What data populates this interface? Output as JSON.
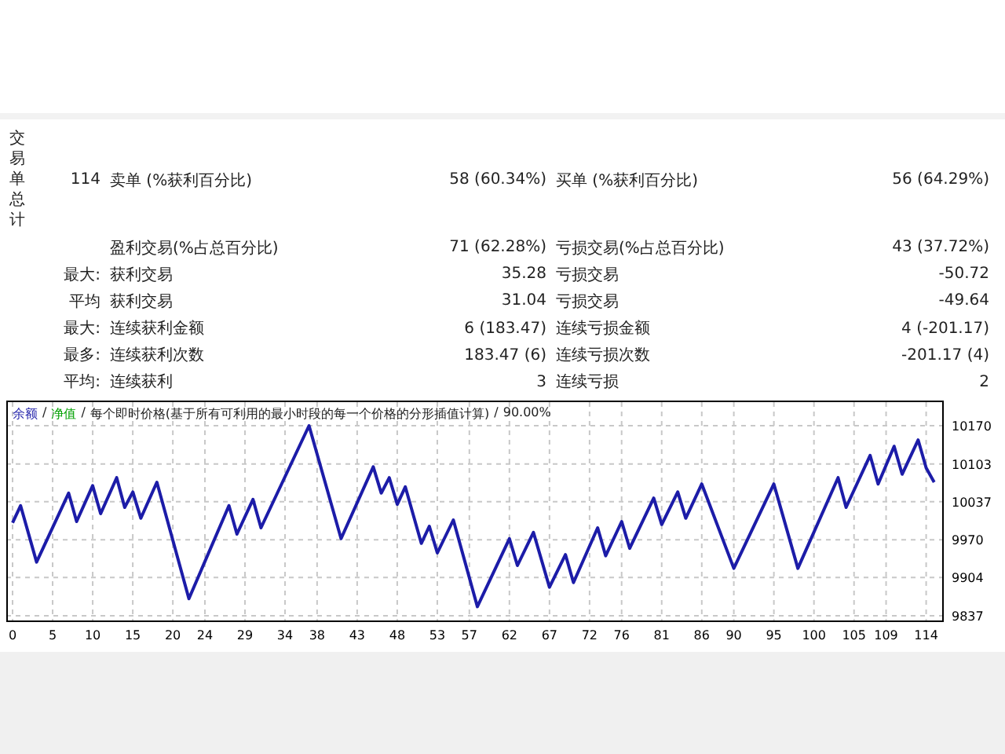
{
  "summary": {
    "side_label": "交易单总计",
    "rows": [
      {
        "prefix": "114",
        "label_1": "卖单 (%获利百分比)",
        "value_1": "58 (60.34%)",
        "label_2": "买单 (%获利百分比)",
        "value_2": "56 (64.29%)"
      },
      {
        "label_1": "盈利交易(%占总百分比)",
        "value_1": "71 (62.28%)",
        "label_2": "亏损交易(%占总百分比)",
        "value_2": "43 (37.72%)"
      },
      {
        "prefix": "最大:",
        "label_1": "获利交易",
        "value_1": "35.28",
        "label_2": "亏损交易",
        "value_2": "-50.72"
      },
      {
        "prefix": "平均",
        "label_1": "获利交易",
        "value_1": "31.04",
        "label_2": "亏损交易",
        "value_2": "-49.64"
      },
      {
        "prefix": "最大:",
        "label_1": "连续获利金额",
        "value_1": "6 (183.47)",
        "label_2": "连续亏损金额",
        "value_2": "4 (-201.17)"
      },
      {
        "prefix": "最多:",
        "label_1": "连续获利次数",
        "value_1": "183.47 (6)",
        "label_2": "连续亏损次数",
        "value_2": "-201.17 (4)"
      },
      {
        "prefix": "平均:",
        "label_1": "连续获利",
        "value_1": "3",
        "label_2": "连续亏损",
        "value_2": "2"
      }
    ]
  },
  "chart": {
    "separator": "/",
    "legend": [
      {
        "label": "净值",
        "color": "#00a000"
      }
    ],
    "model": "每个即时价格(基于所有可利用的最小时段的每一个价格的分形插值计算)",
    "quality": "90.00%",
    "chart_data": {
      "type": "line",
      "grid": true,
      "xlim": [
        0,
        116
      ],
      "ylim": [
        9837,
        10170
      ],
      "xticks": [
        0,
        5,
        10,
        15,
        20,
        24,
        29,
        34,
        38,
        43,
        48,
        53,
        57,
        62,
        67,
        72,
        76,
        81,
        86,
        90,
        95,
        100,
        105,
        109,
        114
      ],
      "yticks": [
        9837,
        9904,
        9970,
        10037,
        10103,
        10170
      ],
      "x": [
        0,
        1,
        3,
        7,
        8,
        10,
        11,
        13,
        14,
        15,
        16,
        18,
        22,
        27,
        28,
        30,
        31,
        37,
        41,
        45,
        46,
        47,
        48,
        49,
        51,
        52,
        53,
        55,
        58,
        62,
        63,
        65,
        67,
        69,
        70,
        73,
        74,
        76,
        77,
        80,
        81,
        83,
        84,
        86,
        90,
        95,
        98,
        103,
        104,
        107,
        108,
        110,
        111,
        113,
        114,
        115
      ],
      "series": [
        {
          "name": "余额",
          "color": "#1c1ca8",
          "values": [
            10000,
            10030,
            9931,
            10052,
            10002,
            10065,
            10016,
            10079,
            10027,
            10054,
            10008,
            10071,
            9867,
            10030,
            9980,
            10041,
            9991,
            10170,
            9972,
            10098,
            10052,
            10079,
            10032,
            10063,
            9964,
            9994,
            9947,
            10005,
            9853,
            9972,
            9925,
            9983,
            9887,
            9944,
            9895,
            9991,
            9942,
            10002,
            9955,
            10043,
            9997,
            10054,
            10008,
            10068,
            9920,
            10068,
            9920,
            10079,
            10027,
            10118,
            10068,
            10134,
            10085,
            10145,
            10096,
            10071
          ]
        }
      ]
    }
  }
}
